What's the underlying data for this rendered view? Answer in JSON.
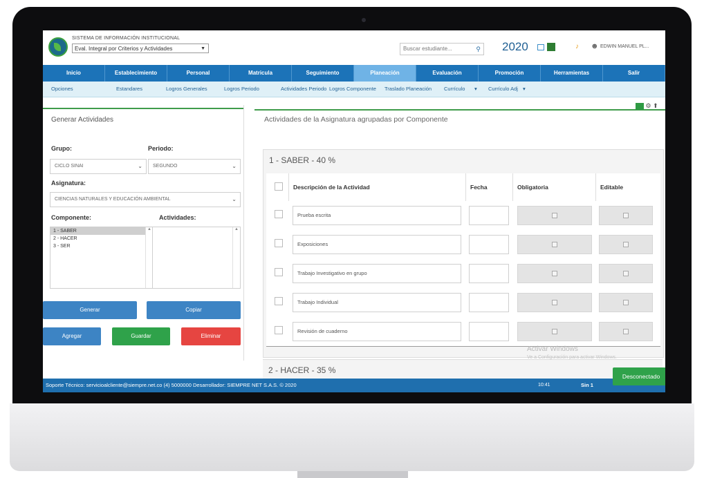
{
  "app": {
    "system_name": "SISTEMA DE INFORMACIÓN INSTITUCIONAL",
    "mode_select": "Eval. Integral por Criterios y Actividades",
    "search_placeholder": "Buscar estudiante...",
    "year": "2020",
    "user_name": "EDWIN MANUEL PL..."
  },
  "menu": [
    "Inicio",
    "Establecimiento",
    "Personal",
    "Matricula",
    "Seguimiento",
    "Planeación",
    "Evaluación",
    "Promoción",
    "Herramientas",
    "Salir"
  ],
  "menu_active_index": 5,
  "submenu": [
    "Opciones",
    "Estandares",
    "Logros Generales",
    "Logros Periodo",
    "Actividades Periodo",
    "Logros Componente",
    "Traslado Planeación",
    "Currículo",
    "Currículo Adj"
  ],
  "left_panel": {
    "title": "Generar Actividades",
    "grupo_label": "Grupo:",
    "grupo_value": "CICLO SINAI",
    "periodo_label": "Periodo:",
    "periodo_value": "SEGUNDO",
    "asignatura_label": "Asignatura:",
    "asignatura_value": "CIENCIAS NATURALES Y EDUCACIÓN AMBIENTAL",
    "componente_label": "Componente:",
    "actividades_label": "Actividades:",
    "componentes": [
      "1 - SABER",
      "2 - HACER",
      "3 - SER"
    ],
    "buttons": {
      "generar": "Generar",
      "copiar": "Copiar",
      "agregar": "Agregar",
      "guardar": "Guardar",
      "eliminar": "Eliminar"
    }
  },
  "main": {
    "title": "Actividades de la Asignatura agrupadas por Componente",
    "component1_title": "1 - SABER - 40 %",
    "component2_title": "2 - HACER - 35 %",
    "columns": [
      "Descripción de la Actividad",
      "Fecha",
      "Obligatoria",
      "Editable"
    ],
    "activities": [
      "Prueba escrita",
      "Exposiciones",
      "Trabajo Investigativo en grupo",
      "Trabajo Individual",
      "Revisión de cuaderno"
    ]
  },
  "watermark": {
    "line1": "Activar Windows",
    "line2": "Ve a Configuración para activar Windows."
  },
  "footer": {
    "text": "Soporte Técnico: servicioalcliente@siempre.net.co (4) 5000000  Desarrollador: SIEMPRE NET S.A.S. © 2020",
    "time": "10:41",
    "lang": "Sin 1"
  },
  "status_button": "Desconectado"
}
